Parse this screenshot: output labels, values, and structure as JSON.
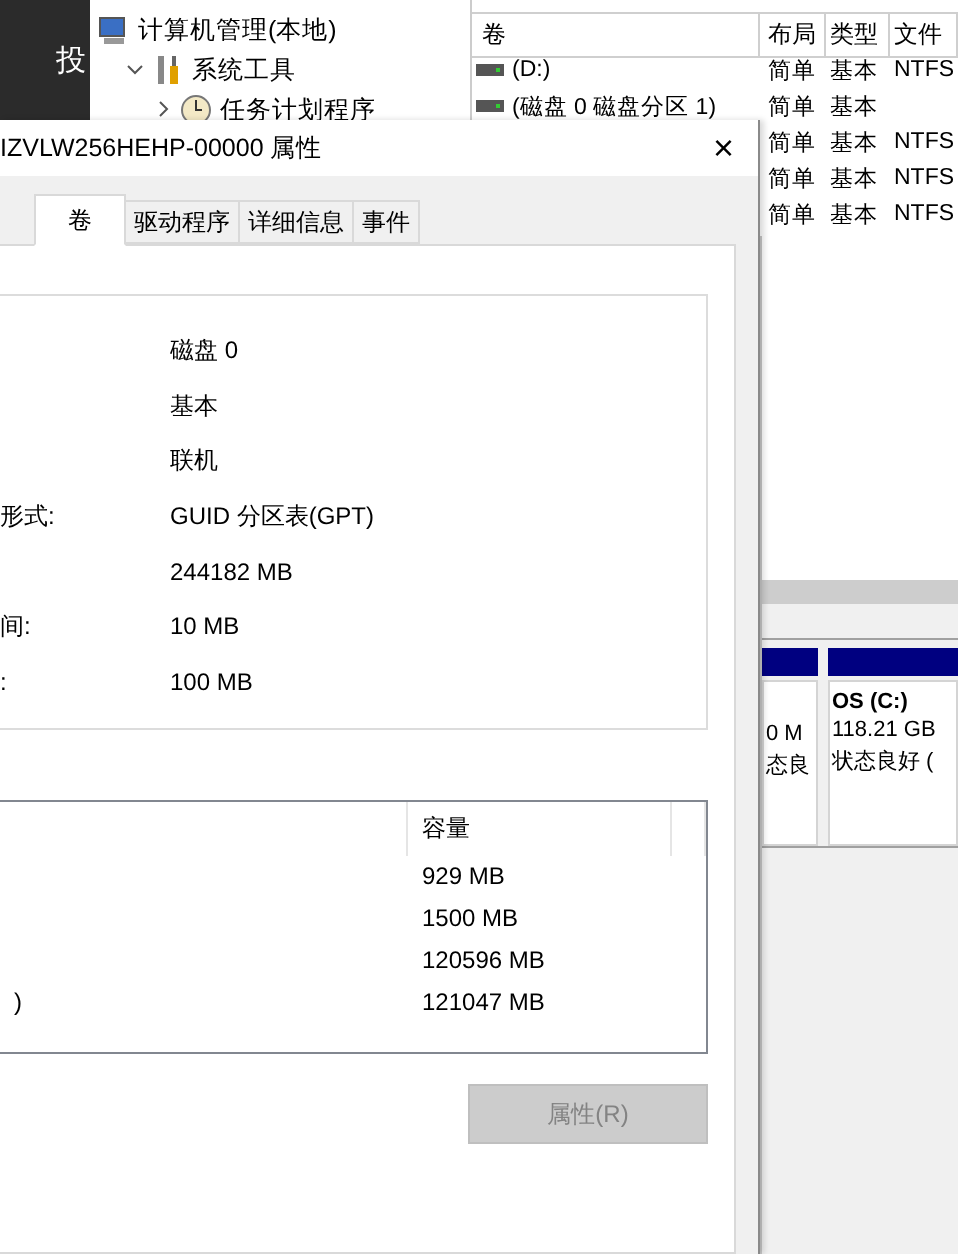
{
  "background_window": {
    "side_text": "投",
    "tree": [
      {
        "label": "计算机管理(本地)",
        "children": [
          {
            "label": "系统工具",
            "expanded": true,
            "children": [
              {
                "label": "任务计划程序",
                "expanded": false
              }
            ]
          }
        ]
      }
    ],
    "volume_list": {
      "columns": [
        "卷",
        "布局",
        "类型",
        "文件"
      ],
      "rows": [
        {
          "volume": "(D:)",
          "layout": "简单",
          "type": "基本",
          "file_system": "NTFS"
        },
        {
          "volume": "(磁盘 0 磁盘分区 1)",
          "layout": "简单",
          "type": "基本"
        },
        {
          "layout": "简单",
          "type": "基本",
          "file_system": "NTFS"
        },
        {
          "layout": "简单",
          "type": "基本",
          "file_system": "NTFS"
        },
        {
          "layout": "简单",
          "type": "基本",
          "file_system": "NTFS"
        }
      ]
    },
    "disk_map": {
      "partitions": [
        {
          "size": "0 M",
          "status": "态良"
        },
        {
          "name": "OS  (C:)",
          "size": "118.21 GB",
          "status": "状态良好 ("
        }
      ]
    }
  },
  "dialog": {
    "title": "IZVLW256HEHP-00000 属性",
    "close_glyph": "×",
    "tabs": [
      {
        "label": "卷",
        "selected": true
      },
      {
        "label": "驱动程序",
        "selected": false
      },
      {
        "label": "详细信息",
        "selected": false
      },
      {
        "label": "事件",
        "selected": false
      }
    ],
    "disk_info": [
      {
        "value": "磁盘 0"
      },
      {
        "value": "基本"
      },
      {
        "value": "联机"
      },
      {
        "label": "形式:",
        "value": "GUID 分区表(GPT)"
      },
      {
        "value": "244182 MB"
      },
      {
        "label": "间:",
        "value": "10 MB"
      },
      {
        "label": ":",
        "value": "100 MB"
      }
    ],
    "volumes": {
      "columns": [
        "容量"
      ],
      "rows": [
        {
          "capacity": "929 MB"
        },
        {
          "capacity": "1500 MB"
        },
        {
          "capacity": "120596 MB"
        },
        {
          "column_1": ")",
          "capacity": "121047 MB"
        }
      ]
    },
    "properties_button": {
      "label": "属性(R)",
      "disabled": true
    }
  }
}
